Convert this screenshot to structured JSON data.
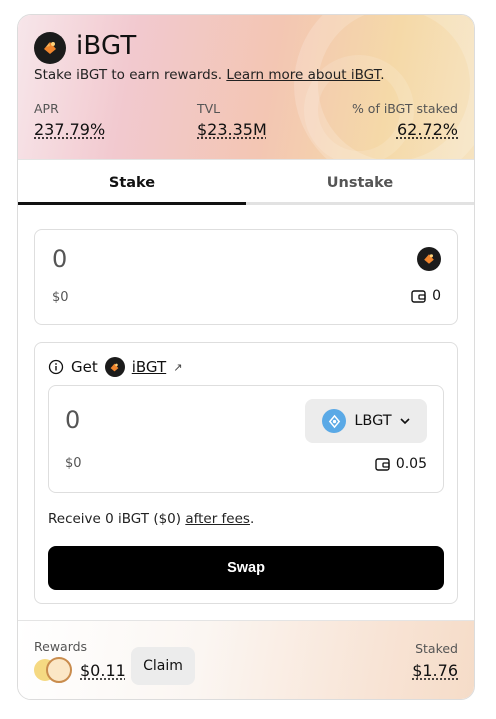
{
  "header": {
    "title": "iBGT",
    "subtitle_text": "Stake iBGT to earn rewards. ",
    "subtitle_link": "Learn more about iBGT",
    "subtitle_end": ".",
    "stats": [
      {
        "label": "APR",
        "value": "237.79%"
      },
      {
        "label": "TVL",
        "value": "$23.35M"
      },
      {
        "label": "% of iBGT staked",
        "value": "62.72%"
      }
    ]
  },
  "tabs": [
    {
      "label": "Stake",
      "active": true
    },
    {
      "label": "Unstake",
      "active": false
    }
  ],
  "stake_input": {
    "amount": "0",
    "usd": "$0",
    "balance": "0",
    "token_icon": "ibgt-token-icon"
  },
  "get_section": {
    "prefix": "Get",
    "token_link": "iBGT",
    "external_icon": "↗",
    "input": {
      "amount": "0",
      "usd": "$0",
      "balance": "0.05",
      "token": "LBGT"
    },
    "receive_text": "Receive 0 iBGT ($0) ",
    "receive_link": "after fees",
    "receive_end": ".",
    "swap_label": "Swap"
  },
  "footer": {
    "rewards_label": "Rewards",
    "rewards_value": "$0.11",
    "claim_label": "Claim",
    "staked_label": "Staked",
    "staked_value": "$1.76"
  },
  "colors": {
    "accent": "#000000",
    "lbgt_blue": "#5aa9e6",
    "ibgt_orange": "#f0852d"
  }
}
